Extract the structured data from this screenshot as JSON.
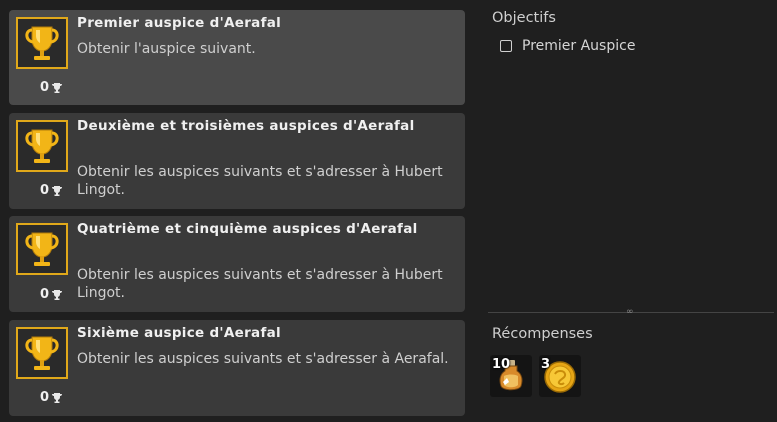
{
  "quests": [
    {
      "title": "Premier auspice d'Aerafal",
      "description": "Obtenir l'auspice suivant.",
      "points": "0"
    },
    {
      "title": "Deuxième et troisièmes auspices d'Aerafal",
      "description": "Obtenir les auspices suivants et s'adresser à Hubert Lingot.",
      "points": "0"
    },
    {
      "title": "Quatrième et cinquième auspices d'Aerafal",
      "description": "Obtenir les auspices suivants et s'adresser à Hubert Lingot.",
      "points": "0"
    },
    {
      "title": "Sixième auspice d'Aerafal",
      "description": "Obtenir les auspices suivants et s'adresser à Aerafal.",
      "points": "0"
    }
  ],
  "objectives": {
    "title": "Objectifs",
    "items": [
      {
        "label": "Premier Auspice",
        "checked": false
      }
    ]
  },
  "rewards": {
    "title": "Récompenses",
    "items": [
      {
        "icon": "potion-icon",
        "count": "10"
      },
      {
        "icon": "gold-coin-icon",
        "count": "3"
      }
    ]
  },
  "colors": {
    "trophy_border": "#e0a81a",
    "gold": "#f2b517"
  }
}
